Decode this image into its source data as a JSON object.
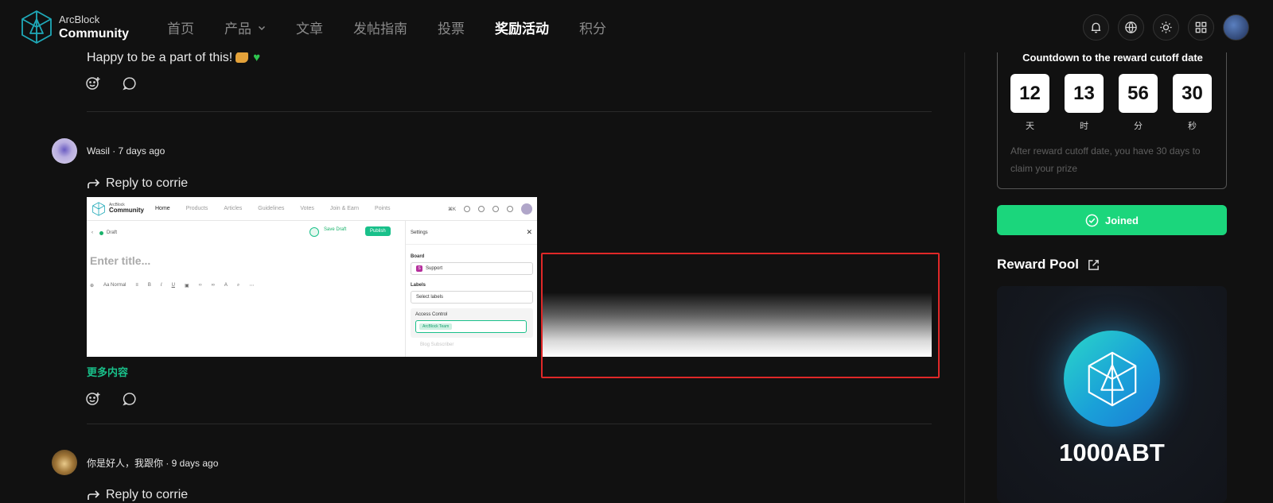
{
  "header": {
    "logo_small": "ArcBlock",
    "logo_big": "Community",
    "nav": [
      "首页",
      "产品",
      "文章",
      "发帖指南",
      "投票",
      "奖励活动",
      "积分"
    ],
    "active_nav": "奖励活动"
  },
  "feed": {
    "prev_comment_text": "Happy to be a part of this!",
    "comments": [
      {
        "author": "Wasil",
        "time": "7 days ago",
        "meta": "Wasil · 7 days ago",
        "reply_label": "Reply to corrie",
        "more_label": "更多内容"
      },
      {
        "author": "你是好人，我跟你",
        "time": "9 days ago",
        "meta": "你是好人，我跟你 · 9 days ago",
        "reply_label": "Reply to corrie"
      }
    ]
  },
  "embedded_screenshot": {
    "logo_small": "ArcBlock",
    "logo_big": "Community",
    "nav": [
      "Home",
      "Products",
      "Articles",
      "Guidelines",
      "Votes",
      "Join & Earn",
      "Points"
    ],
    "shortcut": "⌘K",
    "back_status": "Draft",
    "save_draft": "Save Draft",
    "publish": "Publish",
    "title_placeholder": "Enter title...",
    "toolbar_style": "Normal",
    "settings_title": "Settings",
    "board_label": "Board",
    "board_value": "Support",
    "labels_label": "Labels",
    "labels_placeholder": "Select labels",
    "access_label": "Access Control",
    "access_chip": "ArcBlock Team",
    "access_faded": "Blog Subscriber"
  },
  "sidebar": {
    "countdown_title": "Countdown to the reward cutoff date",
    "countdown": [
      {
        "value": "12",
        "unit": "天"
      },
      {
        "value": "13",
        "unit": "时"
      },
      {
        "value": "56",
        "unit": "分"
      },
      {
        "value": "30",
        "unit": "秒"
      }
    ],
    "countdown_note": "After reward cutoff date, you have 30 days to claim your prize",
    "joined_label": "Joined",
    "pool_title": "Reward Pool",
    "pool_amount": "1000ABT"
  },
  "colors": {
    "accent": "#1bd67c",
    "link_green": "#19c08a",
    "highlight_box": "#e02828",
    "background": "#111111"
  },
  "icons": [
    "bell-icon",
    "globe-icon",
    "sun-icon",
    "grid-icon",
    "emoji-add-icon",
    "comment-icon",
    "reply-icon",
    "check-circle-icon",
    "external-link-icon"
  ]
}
